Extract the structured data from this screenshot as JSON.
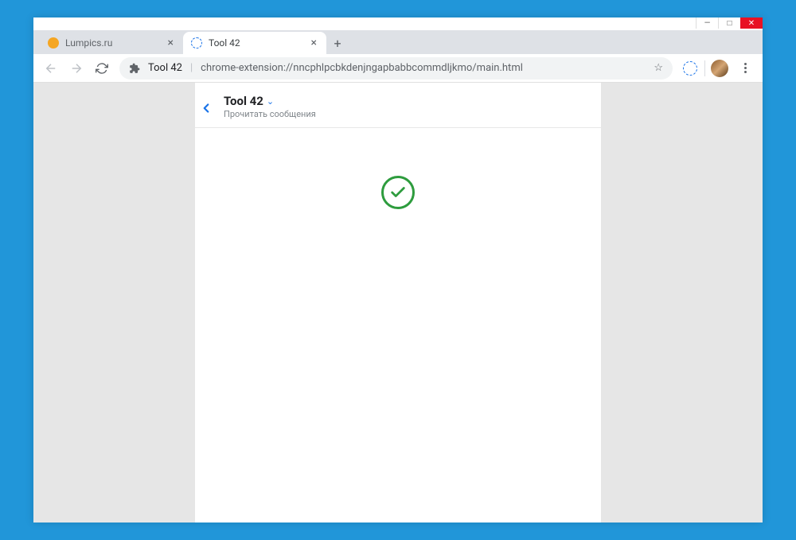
{
  "window": {
    "minimize": "—",
    "maximize": "□",
    "close": "✕"
  },
  "tabs": [
    {
      "title": "Lumpics.ru",
      "favicon_color": "#f5a623",
      "active": false
    },
    {
      "title": "Tool 42",
      "favicon_color": "#1a73e8",
      "active": true
    }
  ],
  "newtab_glyph": "+",
  "addressbar": {
    "site_title": "Tool 42",
    "separator": "|",
    "url": "chrome-extension://nncphlpcbkdenjngapbabbcommdljkmo/main.html",
    "star_glyph": "☆"
  },
  "page": {
    "title": "Tool 42",
    "chevron": "⌄",
    "subtitle": "Прочитать сообщения"
  },
  "colors": {
    "accent": "#1a73e8",
    "success": "#2e9c3e",
    "frame": "#2196d9",
    "close": "#e81123"
  }
}
